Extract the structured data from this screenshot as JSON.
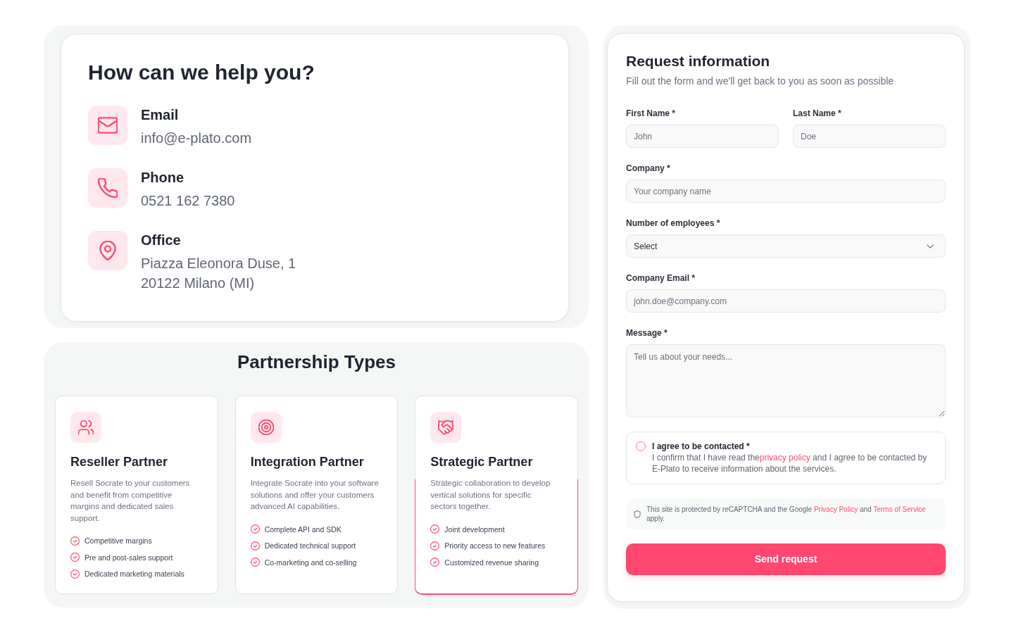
{
  "contact": {
    "title": "How can we help you?",
    "items": [
      {
        "kind": "email",
        "label": "Email",
        "lines": [
          "info@e-plato.com"
        ]
      },
      {
        "kind": "phone",
        "label": "Phone",
        "lines": [
          "0521 162 7380"
        ]
      },
      {
        "kind": "office",
        "label": "Office",
        "lines": [
          "Piazza Eleonora Duse, 1",
          "20122 Milano (MI)"
        ]
      }
    ]
  },
  "partnership": {
    "title": "Partnership Types",
    "cards": [
      {
        "kind": "reseller",
        "title": "Reseller Partner",
        "highlighted": false,
        "description": "Resell Socrate to your customers and benefit from competitive margins and dedicated sales support.",
        "features": [
          "Competitive margins",
          "Pre and post-sales support",
          "Dedicated marketing materials"
        ]
      },
      {
        "kind": "integration",
        "title": "Integration Partner",
        "highlighted": false,
        "description": "Integrate Socrate into your software solutions and offer your customers advanced AI capabilities.",
        "features": [
          "Complete API and SDK",
          "Dedicated technical support",
          "Co-marketing and co-selling"
        ]
      },
      {
        "kind": "strategic",
        "title": "Strategic Partner",
        "highlighted": true,
        "description": "Strategic collaboration to develop vertical solutions for specific sectors together.",
        "features": [
          "Joint development",
          "Priority access to new features",
          "Customized revenue sharing"
        ]
      }
    ]
  },
  "form": {
    "title": "Request information",
    "subtitle": "Fill out the form and we'll get back to you as soon as possible",
    "rows": [
      [
        {
          "kind": "text",
          "label": "First Name *",
          "placeholder": "John"
        },
        {
          "kind": "text",
          "label": "Last Name *",
          "placeholder": "Doe"
        }
      ],
      [
        {
          "kind": "text",
          "label": "Company *",
          "placeholder": "Your company name"
        }
      ],
      [
        {
          "kind": "select",
          "label": "Number of employees *",
          "value": "Select"
        }
      ],
      [
        {
          "kind": "text",
          "label": "Company Email *",
          "placeholder": "john.doe@company.com"
        }
      ],
      [
        {
          "kind": "textarea",
          "label": "Message *",
          "placeholder": "Tell us about your needs..."
        }
      ]
    ],
    "consent": {
      "checked": false,
      "title": "I agree to be contacted *",
      "text": [
        {
          "kind": "text",
          "text": "I confirm that I have read the"
        },
        {
          "kind": "link",
          "text": "privacy policy"
        },
        {
          "kind": "text",
          "text": " and I agree to be contacted by E-Plato to receive information about the services."
        }
      ]
    },
    "notice": {
      "text": [
        {
          "kind": "text",
          "text": "This site is protected by reCAPTCHA and the Google "
        },
        {
          "kind": "link",
          "text": "Privacy Policy"
        },
        {
          "kind": "text",
          "text": " and "
        },
        {
          "kind": "link",
          "text": "Terms of Service"
        },
        {
          "kind": "text",
          "text": " apply."
        }
      ]
    },
    "submit": "Send request"
  }
}
